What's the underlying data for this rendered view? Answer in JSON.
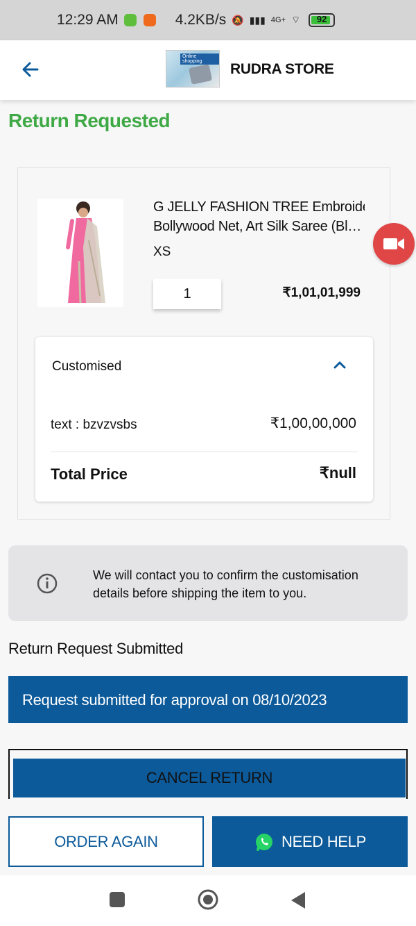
{
  "status_bar": {
    "time": "12:29 AM",
    "network_speed": "4.2KB/s",
    "network_type": "4G+",
    "lte_label": "Vo LTE",
    "battery_level": "92",
    "battery_fraction": 0.92,
    "app_icon_colors": [
      "#5fbf3c",
      "#f06a1d"
    ]
  },
  "header": {
    "store_name": "RUDRA STORE",
    "logo_tag": "Online shopping",
    "back_icon": "back-arrow-icon"
  },
  "order": {
    "status_title": "Return Requested",
    "status_color": "#3fa945",
    "product": {
      "name_line1": "G JELLY FASHION TREE  Embroidered",
      "name_line2": "Bollywood Net, Art Silk Saree  (Black...",
      "size": "XS",
      "quantity": "1",
      "price": "₹1,01,01,999"
    },
    "customisation": {
      "heading": "Customised",
      "expand_icon": "chevron-up-icon",
      "row_label": "text : bzvzvsbs",
      "row_value": "₹1,00,00,000",
      "total_label": "Total Price",
      "total_value": "₹null"
    }
  },
  "info": {
    "icon": "info-icon",
    "text": "We will contact you to confirm the customisation details before shipping the item to you."
  },
  "return_section": {
    "title": "Return Request Submitted",
    "banner": "Request submitted for approval on 08/10/2023",
    "cancel_label": "CANCEL RETURN"
  },
  "actions": {
    "order_again": "ORDER AGAIN",
    "need_help": "NEED HELP",
    "need_help_icon": "whatsapp-icon"
  },
  "colors": {
    "primary": "#0c5a9a",
    "accent_red": "#e04646"
  }
}
